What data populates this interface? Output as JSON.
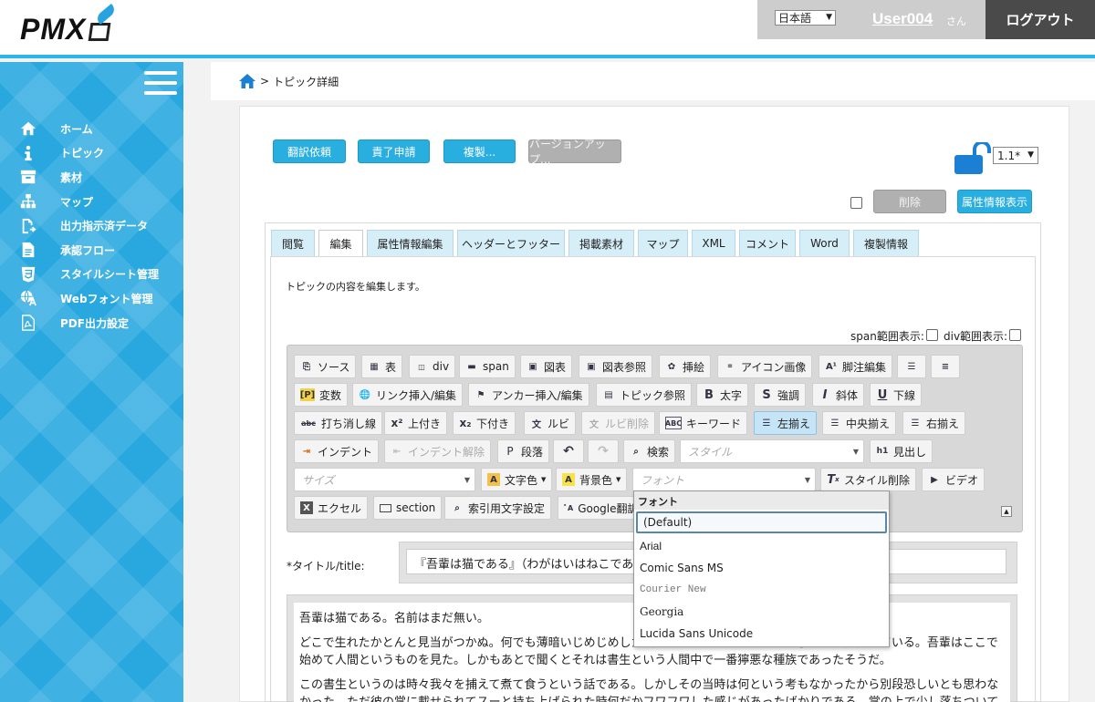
{
  "header": {
    "logo_text": "PMX",
    "language": "日本語",
    "user_name": "User004",
    "user_suffix": "さん",
    "logout_label": "ログアウト"
  },
  "sidebar": {
    "items": [
      {
        "label": "ホーム",
        "icon": "home-icon"
      },
      {
        "label": "トピック",
        "icon": "info-icon"
      },
      {
        "label": "素材",
        "icon": "archive-icon"
      },
      {
        "label": "マップ",
        "icon": "sitemap-icon"
      },
      {
        "label": "出力指示済データ",
        "icon": "export-file-icon"
      },
      {
        "label": "承認フロー",
        "icon": "document-icon"
      },
      {
        "label": "スタイルシート管理",
        "icon": "css3-icon"
      },
      {
        "label": "Webフォント管理",
        "icon": "translate-icon"
      },
      {
        "label": "PDF出力設定",
        "icon": "pdf-icon"
      }
    ]
  },
  "breadcrumb": {
    "separator": ">",
    "current": "トピック詳細"
  },
  "actions": {
    "translate_request": "翻訳依頼",
    "responsibility_request": "責了申請",
    "copy": "複製...",
    "version_up": "バージョンアップ...",
    "delete": "削除",
    "show_attributes": "属性情報表示",
    "version": "1.1*"
  },
  "tabs": [
    "閲覧",
    "編集",
    "属性情報編集",
    "ヘッダーとフッター",
    "掲載素材",
    "マップ",
    "XML",
    "コメント",
    "Word",
    "複製情報"
  ],
  "active_tab": "編集",
  "editor": {
    "description": "トピックの内容を編集します。",
    "span_label": "span範囲表示:",
    "div_label": "div範囲表示:",
    "toolbar": {
      "source": "ソース",
      "table": "表",
      "div": "div",
      "span": "span",
      "figure": "図表",
      "figure_ref": "図表参照",
      "illustration": "挿絵",
      "icon_image": "アイコン画像",
      "footnote": "脚注編集",
      "variable": "変数",
      "link": "リンク挿入/編集",
      "anchor": "アンカー挿入/編集",
      "topic_ref": "トピック参照",
      "bold": "太字",
      "emphasis": "強調",
      "italic": "斜体",
      "underline": "下線",
      "strike": "打ち消し線",
      "superscript": "上付き",
      "subscript": "下付き",
      "ruby": "ルビ",
      "ruby_delete": "ルビ削除",
      "keyword": "キーワード",
      "align_left": "左揃え",
      "align_center": "中央揃え",
      "align_right": "右揃え",
      "indent": "インデント",
      "outdent": "インデント解除",
      "paragraph": "段落",
      "search": "検索",
      "style_placeholder": "スタイル",
      "heading": "見出し",
      "size_placeholder": "サイズ",
      "text_color": "文字色",
      "bg_color": "背景色",
      "font_placeholder": "フォント",
      "clear_style": "スタイル削除",
      "video": "ビデオ",
      "excel": "エクセル",
      "section": "section",
      "index_setting": "索引用文字設定",
      "google_translate": "Google翻訳"
    }
  },
  "title_field": {
    "label": "*タイトル/title:",
    "value": "『吾輩は猫である』（わがはいはねこであ"
  },
  "body_text": [
    "吾輩は猫である。名前はまだ無い。",
    "どこで生れたかとんと見当がつかぬ。何でも薄暗いじめじめした所でニャーニャー泣いていた事だけは記憶している。吾輩はここで始めて人間というものを見た。しかもあとで聞くとそれは書生という人間中で一番獰悪な種族であったそうだ。",
    "この書生というのは時々我々を捕えて煮て食うという話である。しかしその当時は何という考もなかったから別段恐しいとも思わなかった。ただ彼の掌に載せられてスーと持ち上げられた時何だかフワフワした感じがあったばかりである。掌の上で少し落ちついて"
  ],
  "font_dropdown": {
    "header": "フォント",
    "options": [
      "(Default)",
      "Arial",
      "Comic Sans MS",
      "Courier New",
      "Georgia",
      "Lucida Sans Unicode"
    ],
    "selected": "(Default)"
  },
  "colors": {
    "accent": "#29aee0",
    "sidebar": "#29a8e0",
    "logout_bg": "#4a4a4a"
  }
}
